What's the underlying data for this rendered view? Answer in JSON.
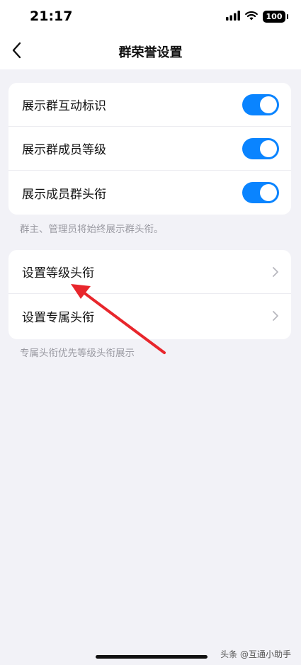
{
  "status_bar": {
    "time": "21:17",
    "battery": "100",
    "icons": [
      "signal-icon",
      "wifi-icon",
      "battery-icon"
    ]
  },
  "nav": {
    "title": "群荣誉设置",
    "back_icon": "chevron-left-icon"
  },
  "toggles_section": {
    "items": [
      {
        "label": "展示群互动标识",
        "on": true
      },
      {
        "label": "展示群成员等级",
        "on": true
      },
      {
        "label": "展示成员群头衔",
        "on": true
      }
    ],
    "note": "群主、管理员将始终展示群头衔。"
  },
  "titles_section": {
    "items": [
      {
        "label": "设置等级头衔"
      },
      {
        "label": "设置专属头衔"
      }
    ],
    "note": "专属头衔优先等级头衔展示"
  },
  "annotation": {
    "color": "#e8262c"
  },
  "colors": {
    "accent": "#0a84ff",
    "background": "#f2f2f7",
    "card": "#ffffff"
  },
  "watermark": "头条 @互通小助手"
}
